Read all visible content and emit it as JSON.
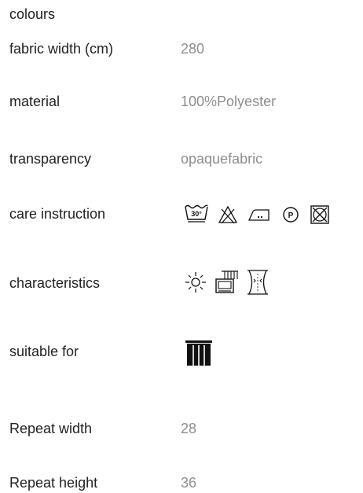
{
  "specs": {
    "colours": {
      "label": "colours"
    },
    "fabric_width": {
      "label": "fabric width (cm)",
      "value": "280"
    },
    "material": {
      "label": "material",
      "value": "100%Polyester"
    },
    "transparency": {
      "label": "transparency",
      "value": "opaquefabric"
    },
    "care": {
      "label": "care instruction",
      "icons": [
        "wash-30-gentle-icon",
        "do-not-bleach-icon",
        "iron-low-icon",
        "dry-clean-p-icon",
        "do-not-tumble-dry-icon"
      ],
      "wash_temp": "30°",
      "dry_clean_letter": "P"
    },
    "characteristics": {
      "label": "characteristics",
      "icons": [
        "lightfast-sun-icon",
        "machine-washable-icon",
        "flame-retardant-icon"
      ]
    },
    "suitable_for": {
      "label": "suitable for",
      "icons": [
        "curtain-icon"
      ]
    },
    "repeat_width": {
      "label": "Repeat width",
      "value": "28"
    },
    "repeat_height": {
      "label": "Repeat height",
      "value": "36"
    }
  },
  "colors": {
    "label": "#222222",
    "value": "#8e8e8e",
    "icon": "#111111"
  }
}
